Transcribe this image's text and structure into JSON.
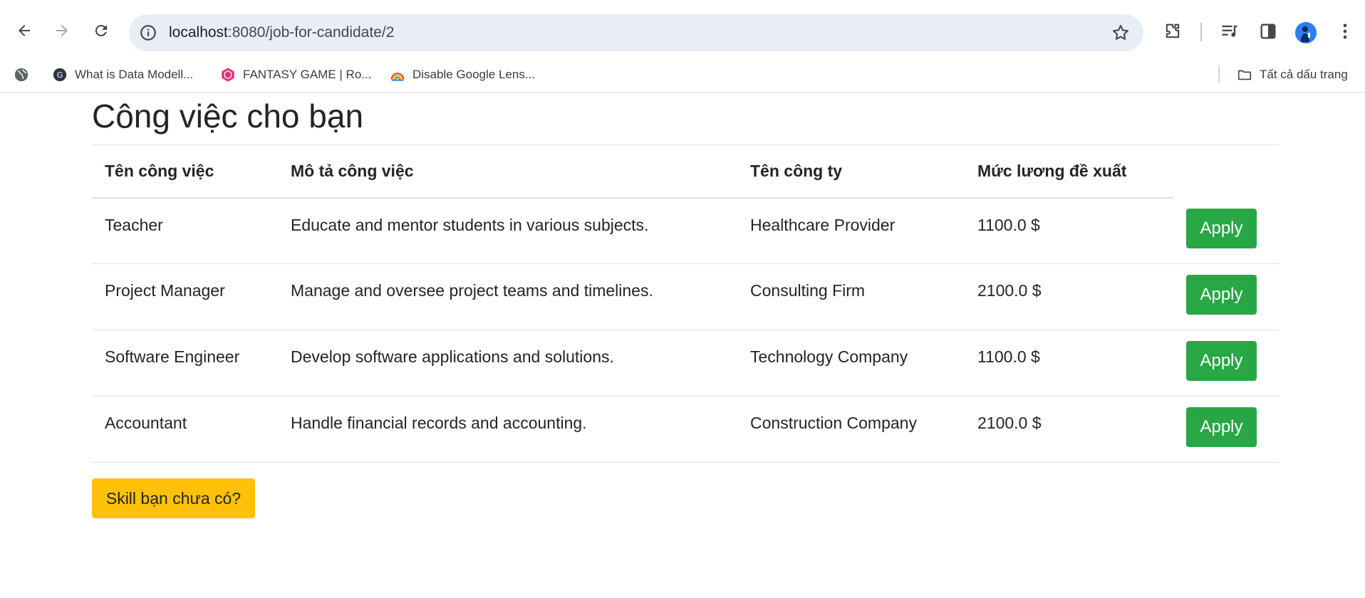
{
  "browser": {
    "url_host": "localhost",
    "url_path": ":8080/job-for-candidate/2",
    "bookmarks": [
      {
        "label": "What is Data Modell...",
        "icon": "g-logo-icon"
      },
      {
        "label": "FANTASY GAME | Ro...",
        "icon": "fantasy-game-icon"
      },
      {
        "label": "Disable Google Lens...",
        "icon": "rainbow-icon"
      }
    ],
    "all_bookmarks_label": "Tất cả dấu trang"
  },
  "page": {
    "title": "Công việc cho bạn",
    "table": {
      "headers": [
        "Tên công việc",
        "Mô tả công việc",
        "Tên công ty",
        "Mức lương đề xuất"
      ],
      "rows": [
        {
          "name": "Teacher",
          "description": "Educate and mentor students in various subjects.",
          "company": "Healthcare Provider",
          "salary": "1100.0 $",
          "action": "Apply"
        },
        {
          "name": "Project Manager",
          "description": "Manage and oversee project teams and timelines.",
          "company": "Consulting Firm",
          "salary": "2100.0 $",
          "action": "Apply"
        },
        {
          "name": "Software Engineer",
          "description": "Develop software applications and solutions.",
          "company": "Technology Company",
          "salary": "1100.0 $",
          "action": "Apply"
        },
        {
          "name": "Accountant",
          "description": "Handle financial records and accounting.",
          "company": "Construction Company",
          "salary": "2100.0 $",
          "action": "Apply"
        }
      ]
    },
    "skill_button": "Skill bạn chưa có?"
  },
  "colors": {
    "apply_button": "#28a745",
    "skill_button": "#ffc107",
    "omnibox": "#e9eef6"
  }
}
